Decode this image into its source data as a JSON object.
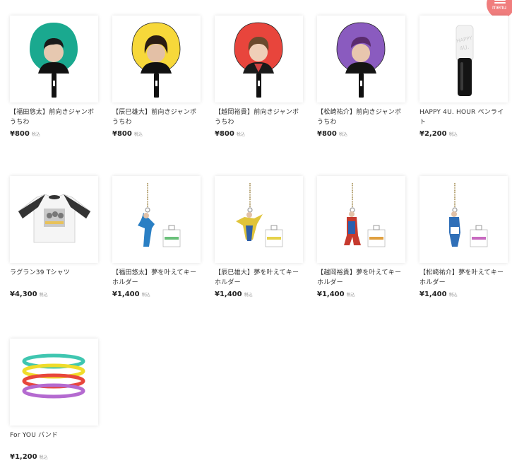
{
  "menu": {
    "label": "menu",
    "icon": "hamburger-icon"
  },
  "products": [
    {
      "name": "【福田悠太】前向きジャンボうちわ",
      "price": "¥800",
      "tax": "税込",
      "image": "uchiwa-teal"
    },
    {
      "name": "【辰巳雄大】前向きジャンボうちわ",
      "price": "¥800",
      "tax": "税込",
      "image": "uchiwa-yellow"
    },
    {
      "name": "【越岡裕貴】前向きジャンボうちわ",
      "price": "¥800",
      "tax": "税込",
      "image": "uchiwa-red"
    },
    {
      "name": "【松崎祐介】前向きジャンボうちわ",
      "price": "¥800",
      "tax": "税込",
      "image": "uchiwa-purple"
    },
    {
      "name": "HAPPY 4U. HOUR ペンライト",
      "price": "¥2,200",
      "tax": "税込",
      "image": "penlight"
    },
    {
      "name": "ラグラン39 Tシャツ",
      "price": "¥4,300",
      "tax": "税込",
      "image": "raglan-shirt"
    },
    {
      "name": "【福田悠太】夢を叶えてキーホルダー",
      "price": "¥1,400",
      "tax": "税込",
      "image": "keychain"
    },
    {
      "name": "【辰巳雄大】夢を叶えてキーホルダー",
      "price": "¥1,400",
      "tax": "税込",
      "image": "keychain"
    },
    {
      "name": "【越岡裕貴】夢を叶えてキーホルダー",
      "price": "¥1,400",
      "tax": "税込",
      "image": "keychain"
    },
    {
      "name": "【松崎祐介】夢を叶えてキーホルダー",
      "price": "¥1,400",
      "tax": "税込",
      "image": "keychain"
    },
    {
      "name": "For YOU バンド",
      "price": "¥1,200",
      "tax": "税込",
      "image": "rubber-bands"
    }
  ],
  "colors": {
    "accent_menu": "#f07d7d",
    "uchiwa_teal": "#1aa98f",
    "uchiwa_yellow": "#f7d83a",
    "uchiwa_red": "#e8453c",
    "uchiwa_purple": "#8a5bbf"
  }
}
